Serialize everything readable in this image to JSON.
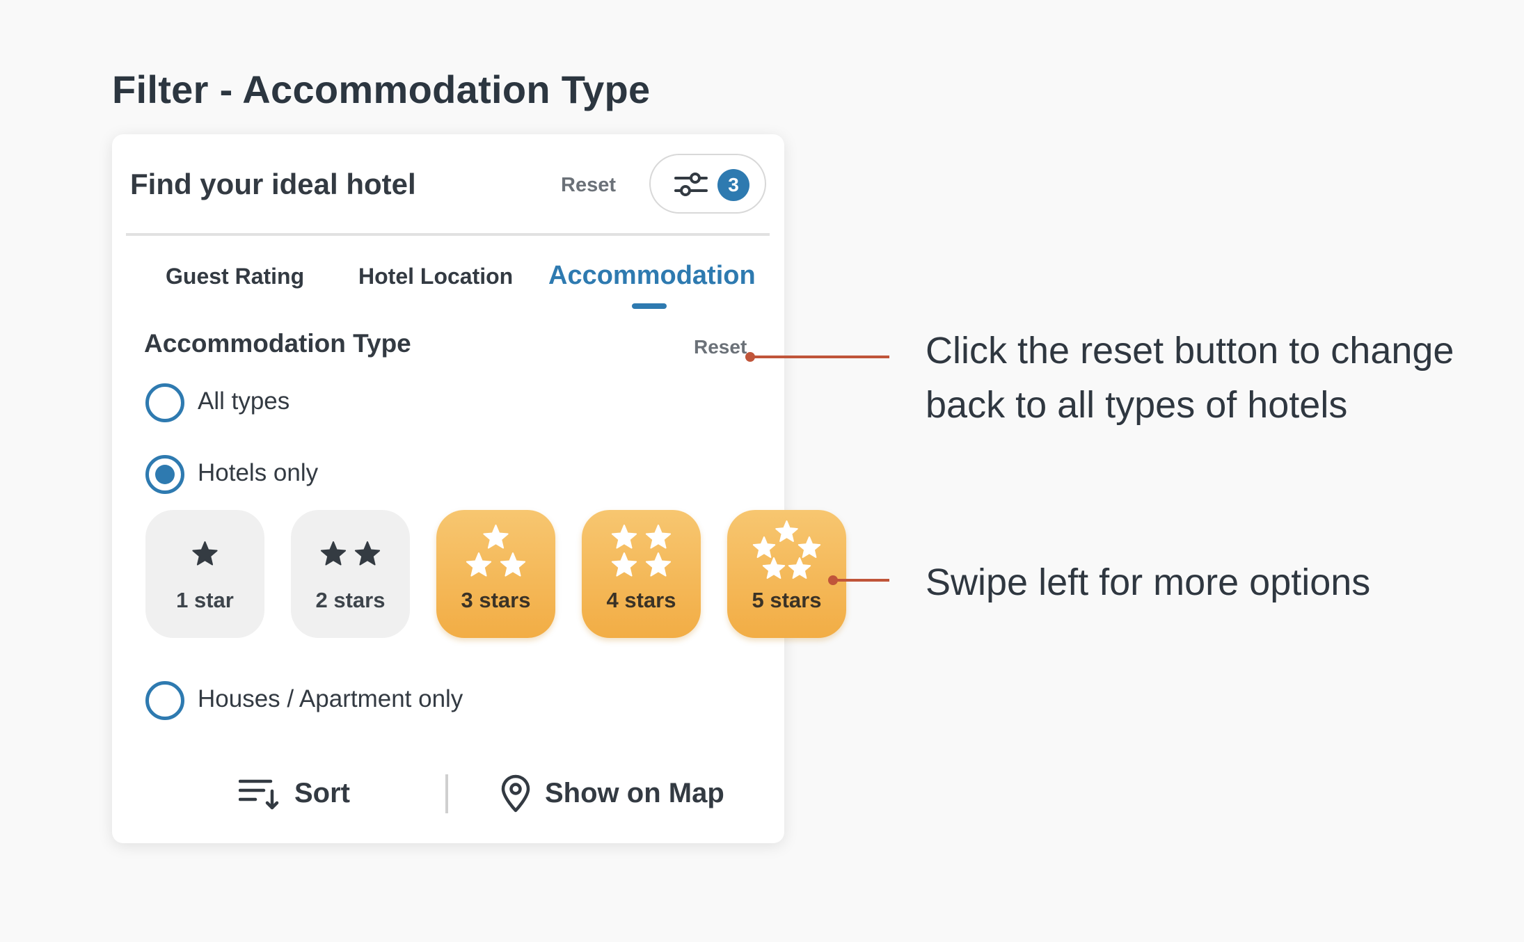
{
  "page": {
    "title": "Filter - Accommodation Type"
  },
  "panel": {
    "title": "Find your ideal hotel",
    "reset_label": "Reset",
    "filter_count": "3"
  },
  "tabs": [
    {
      "label": "Guest Rating",
      "active": false
    },
    {
      "label": "Hotel Location",
      "active": false
    },
    {
      "label": "Accommodation",
      "active": true
    }
  ],
  "section": {
    "title": "Accommodation Type",
    "reset_label": "Reset",
    "options": [
      {
        "label": "All types",
        "selected": false
      },
      {
        "label": "Hotels only",
        "selected": true
      },
      {
        "label": "Houses / Apartment only",
        "selected": false
      }
    ]
  },
  "star_options": [
    {
      "label": "1 star",
      "stars": 1,
      "selected": false
    },
    {
      "label": "2 stars",
      "stars": 2,
      "selected": false
    },
    {
      "label": "3 stars",
      "stars": 3,
      "selected": true
    },
    {
      "label": "4 stars",
      "stars": 4,
      "selected": true
    },
    {
      "label": "5 stars",
      "stars": 5,
      "selected": true
    }
  ],
  "footer": {
    "sort_label": "Sort",
    "map_label": "Show on Map"
  },
  "annotations": [
    {
      "text": "Click the reset button to change back to all types of hotels"
    },
    {
      "text": "Swipe left for more options"
    }
  ],
  "colors": {
    "accent": "#2e7ab0",
    "selected_tile": "#f2ad45",
    "annotation_line": "#c0553a"
  },
  "icons": {
    "filter": "sliders-icon",
    "star": "star-icon",
    "sort": "sort-icon",
    "map": "map-pin-icon"
  }
}
